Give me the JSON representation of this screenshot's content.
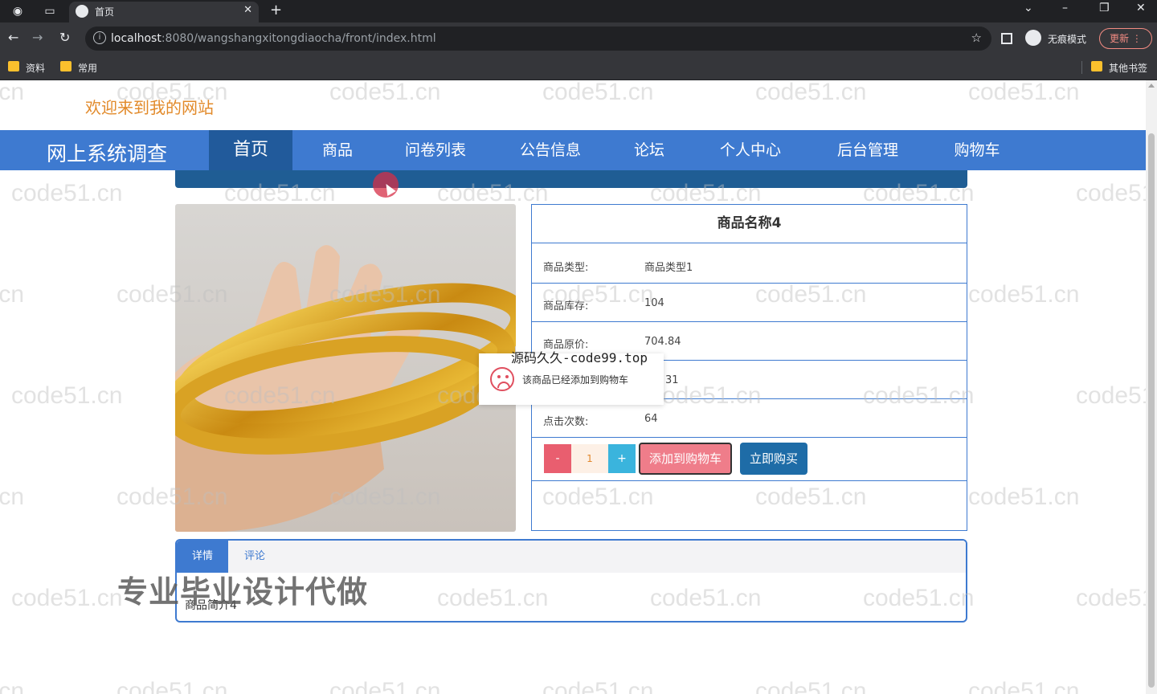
{
  "browser": {
    "tab_title": "首页",
    "url_host": "localhost",
    "url_rest": ":8080/wangshangxitongdiaocha/front/index.html",
    "incognito_label": "无痕模式",
    "update_label": "更新",
    "bookmarks": [
      "资料",
      "常用"
    ],
    "other_bookmarks": "其他书签"
  },
  "site": {
    "welcome": "欢迎来到我的网站",
    "brand": "网上系统调查",
    "nav": [
      "首页",
      "商品",
      "问卷列表",
      "公告信息",
      "论坛",
      "个人中心",
      "后台管理",
      "购物车"
    ],
    "active_nav": "首页"
  },
  "product": {
    "name": "商品名称4",
    "rows": [
      {
        "label": "商品类型:",
        "value": "商品类型1"
      },
      {
        "label": "商品库存:",
        "value": "104"
      },
      {
        "label": "商品原价:",
        "value": "704.84"
      },
      {
        "label": "",
        "value": "31"
      },
      {
        "label": "点击次数:",
        "value": "64"
      }
    ],
    "qty_minus": "-",
    "quantity": "1",
    "qty_plus": "+",
    "add_to_cart": "添加到购物车",
    "buy_now": "立即购买"
  },
  "toast": {
    "overlay": "源码久久-code99.top",
    "message": "该商品已经添加到购物车"
  },
  "tabs": {
    "detail": "详情",
    "comment": "评论",
    "content": "商品简介4"
  },
  "promo": "专业毕业设计代做",
  "watermark": "code51.cn",
  "colors": {
    "nav_bg": "#3e7ad0",
    "nav_active": "#215a9b",
    "cart_btn": "#ef7d8a",
    "buy_btn": "#1e6ca7",
    "welcome": "#e28a2a"
  }
}
